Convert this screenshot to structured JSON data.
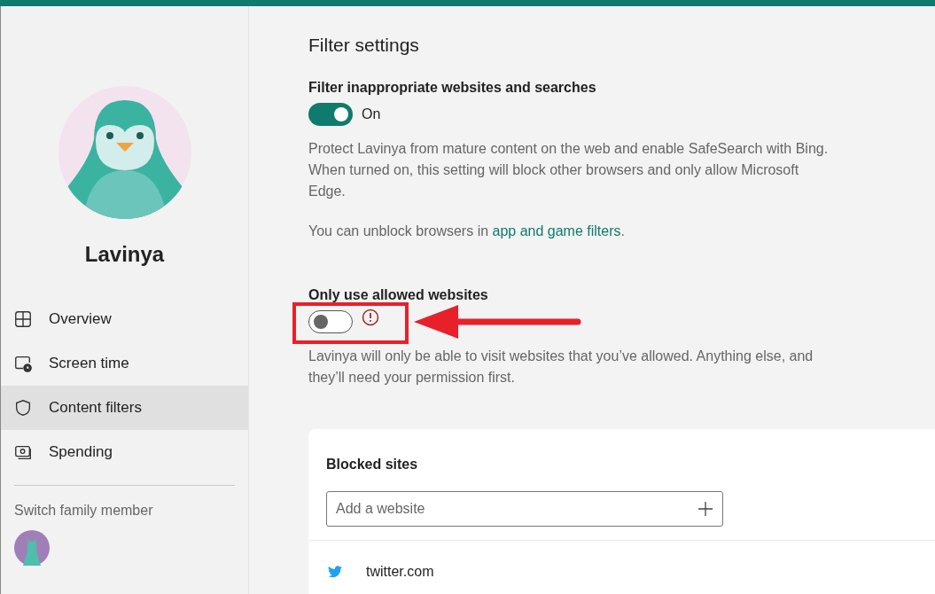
{
  "profile": {
    "name": "Lavinya"
  },
  "nav": [
    {
      "kind": "overview",
      "label": "Overview",
      "selected": false
    },
    {
      "kind": "screen-time",
      "label": "Screen time",
      "selected": false
    },
    {
      "kind": "content-filters",
      "label": "Content filters",
      "selected": true
    },
    {
      "kind": "spending",
      "label": "Spending",
      "selected": false
    }
  ],
  "switch_member": {
    "label": "Switch family member"
  },
  "main": {
    "title": "Filter settings",
    "settings": [
      {
        "title": "Filter inappropriate websites and searches",
        "on": true,
        "state_label": "On",
        "warning": false,
        "highlighted": false,
        "paragraphs": [
          {
            "text": "Protect Lavinya from mature content on the web and enable SafeSearch with Bing. When turned on, this setting will block other browsers and only allow Microsoft Edge."
          },
          {
            "text": "You can unblock browsers in ",
            "link": "app and game filters",
            "after": "."
          }
        ]
      },
      {
        "title": "Only use allowed websites",
        "on": false,
        "warning": true,
        "highlighted": true,
        "paragraphs": [
          {
            "text": "Lavinya will only be able to visit websites that you’ve allowed. Anything else, and they’ll need your permission first."
          }
        ]
      }
    ]
  },
  "blocked": {
    "title": "Blocked sites",
    "placeholder": "Add a website",
    "sites": [
      "twitter.com"
    ]
  }
}
